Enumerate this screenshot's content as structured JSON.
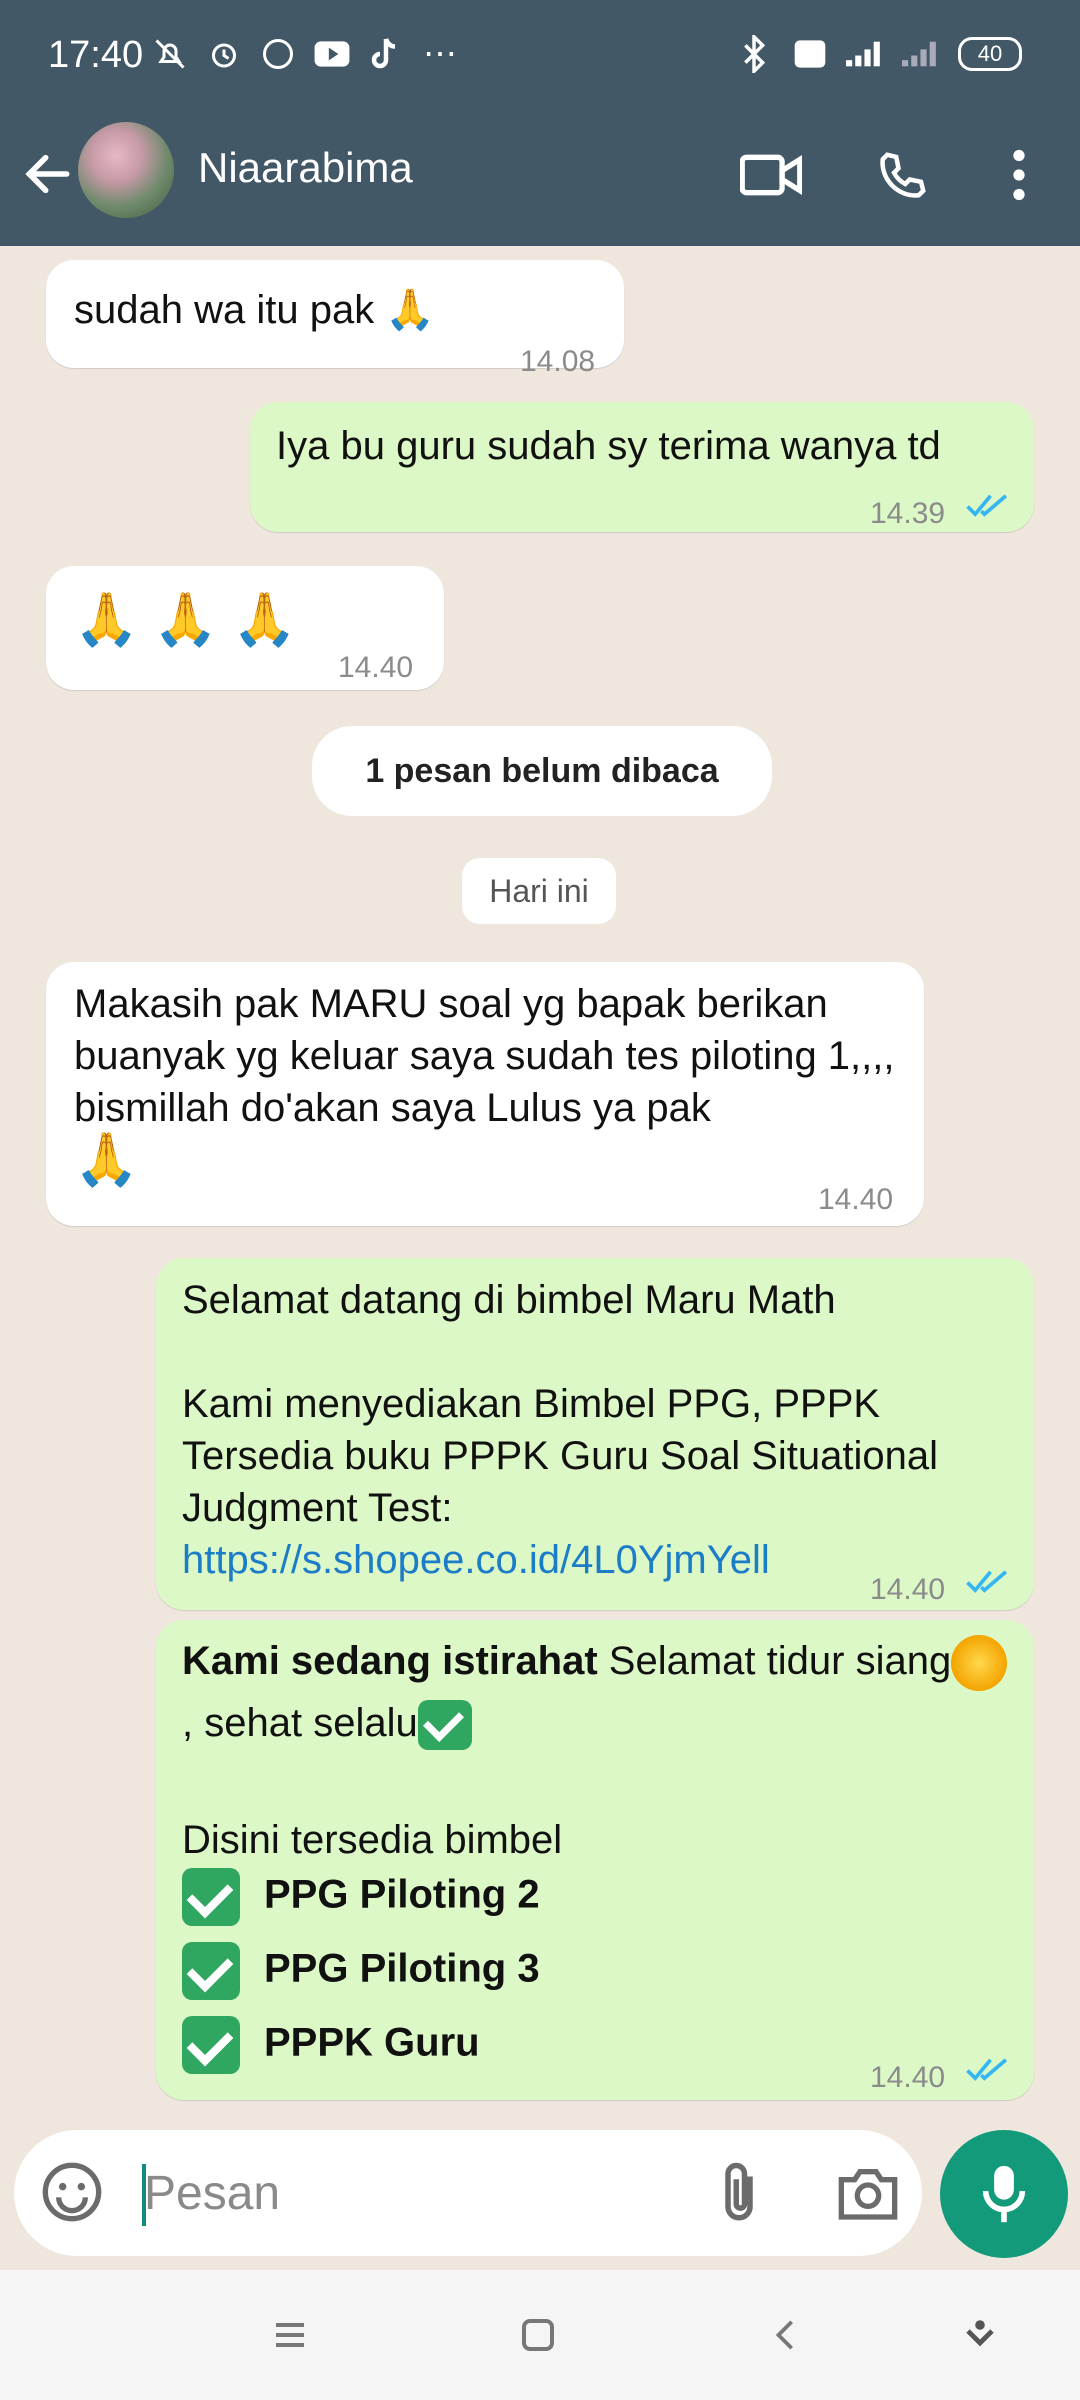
{
  "status_bar": {
    "time": "17:40",
    "battery": "40"
  },
  "header": {
    "contact_name": "Niaarabima"
  },
  "messages": {
    "m1": {
      "text": "sudah wa itu pak 🙏",
      "time": "14.08"
    },
    "m2": {
      "text": "Iya bu guru sudah sy terima wanya td",
      "time": "14.39"
    },
    "m3": {
      "text": "🙏 🙏 🙏",
      "time": "14.40"
    },
    "unread": "1 pesan belum dibaca",
    "date": "Hari ini",
    "m4": {
      "text": "Makasih pak MARU soal yg bapak berikan buanyak yg keluar saya sudah tes piloting 1,,,, bismillah do'akan saya Lulus ya pak",
      "emoji": "🙏",
      "time": "14.40"
    },
    "m5": {
      "line1": "Selamat datang di bimbel Maru Math",
      "line2": "Kami menyediakan Bimbel PPG, PPPK Tersedia buku PPPK Guru Soal Situational Judgment Test: ",
      "link": "https://s.shopee.co.id/4L0YjmYell",
      "time": "14.40"
    },
    "m6": {
      "bold": "Kami sedang istirahat",
      "text1": " Selamat tidur siang",
      "text2": ", sehat selalu",
      "line2": "Disini tersedia bimbel",
      "items": [
        "PPG Piloting 2",
        "PPG Piloting 3",
        "PPPK Guru"
      ],
      "time": "14.40"
    }
  },
  "input": {
    "placeholder": "Pesan"
  }
}
